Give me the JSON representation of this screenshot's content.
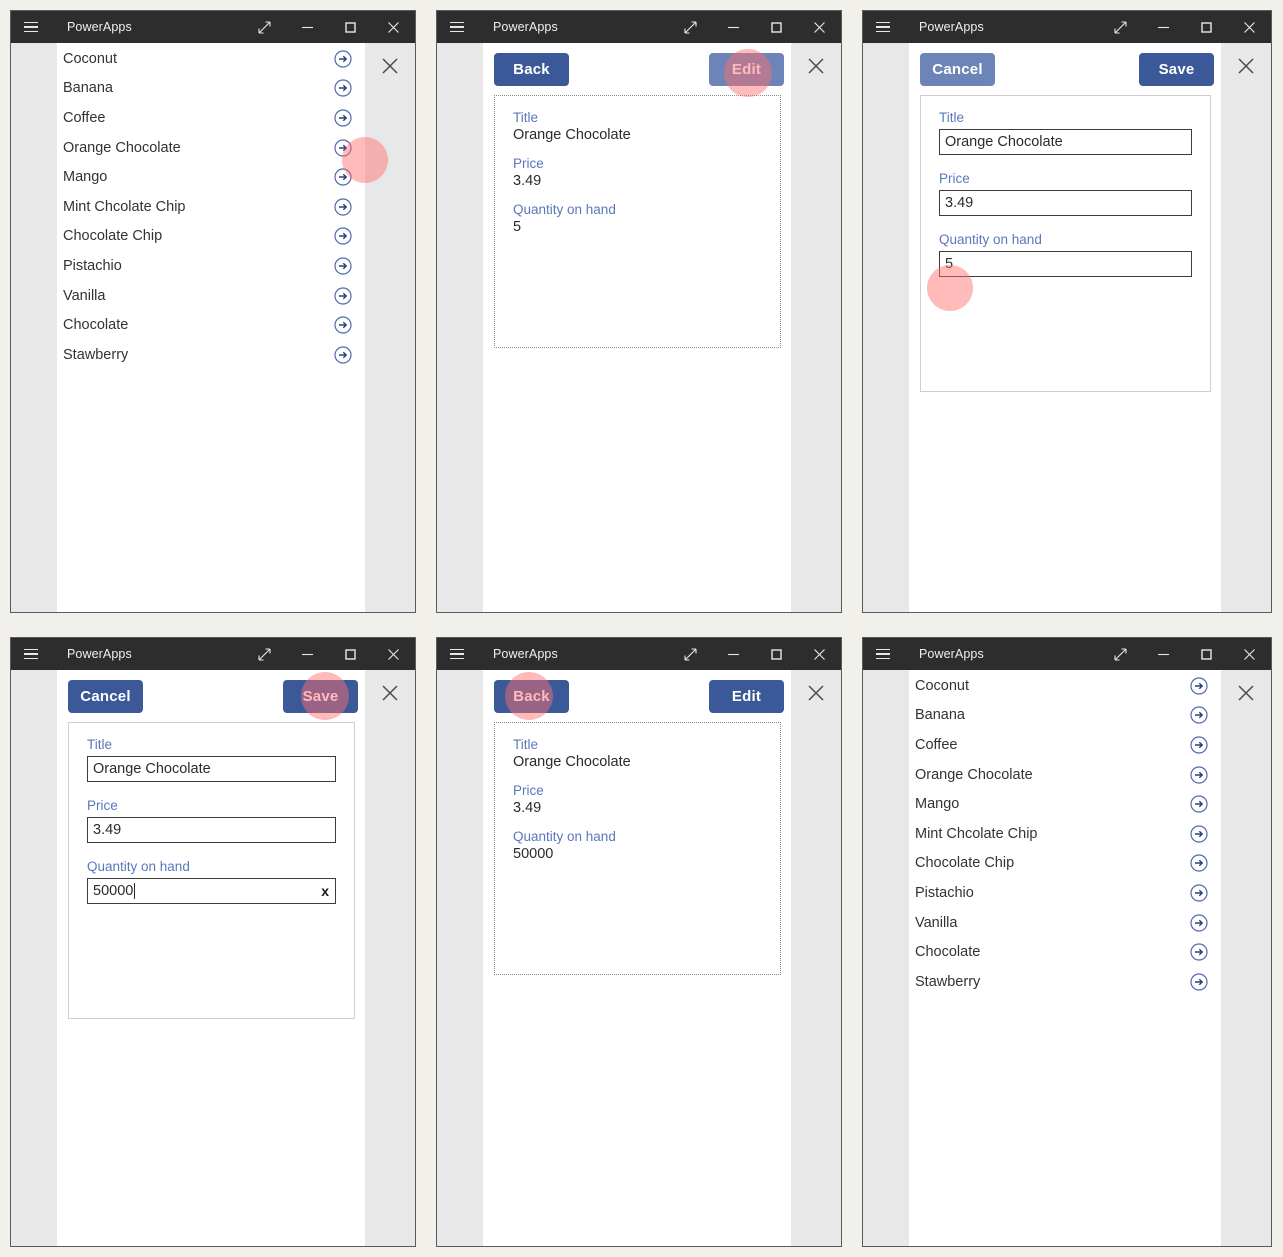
{
  "window": {
    "title": "PowerApps",
    "controls": {
      "menu": "hamburger-menu",
      "restore": "restore-arrows",
      "minimize": "minimize",
      "maximize": "maximize",
      "close": "close"
    },
    "app_close_label": "close-app"
  },
  "colors": {
    "accent": "#3b5998",
    "accent_hover": "#6c84b8",
    "label_blue": "#5a78bb",
    "titlebar": "#2d2d2d",
    "page_bg": "#f1f0ea",
    "app_bg": "#e8e8e8",
    "highlight": "#ff6e6e"
  },
  "gallery": {
    "items": [
      {
        "label": "Coconut"
      },
      {
        "label": "Banana"
      },
      {
        "label": "Coffee"
      },
      {
        "label": "Orange Chocolate"
      },
      {
        "label": "Mango"
      },
      {
        "label": "Mint Chcolate Chip"
      },
      {
        "label": "Chocolate Chip"
      },
      {
        "label": "Pistachio"
      },
      {
        "label": "Vanilla"
      },
      {
        "label": "Chocolate"
      },
      {
        "label": "Stawberry"
      }
    ]
  },
  "detail_before": {
    "back_label": "Back",
    "edit_label": "Edit",
    "fields": [
      {
        "label": "Title",
        "value": "Orange Chocolate"
      },
      {
        "label": "Price",
        "value": "3.49"
      },
      {
        "label": "Quantity on hand",
        "value": "5"
      }
    ]
  },
  "detail_after": {
    "back_label": "Back",
    "edit_label": "Edit",
    "fields": [
      {
        "label": "Title",
        "value": "Orange Chocolate"
      },
      {
        "label": "Price",
        "value": "3.49"
      },
      {
        "label": "Quantity on hand",
        "value": "50000"
      }
    ]
  },
  "edit_before": {
    "cancel_label": "Cancel",
    "save_label": "Save",
    "fields": [
      {
        "label": "Title",
        "value": "Orange Chocolate"
      },
      {
        "label": "Price",
        "value": "3.49"
      },
      {
        "label": "Quantity on hand",
        "value": "5"
      }
    ]
  },
  "edit_after": {
    "cancel_label": "Cancel",
    "save_label": "Save",
    "fields": [
      {
        "label": "Title",
        "value": "Orange Chocolate"
      },
      {
        "label": "Price",
        "value": "3.49"
      },
      {
        "label": "Quantity on hand",
        "value": "50000"
      }
    ],
    "clear_icon": "x"
  },
  "panels": [
    {
      "id": "panel-1",
      "screen": "gallery",
      "highlight": "gallery-row-orange-chocolate-arrow"
    },
    {
      "id": "panel-2",
      "screen": "detail-before",
      "highlight": "edit-button"
    },
    {
      "id": "panel-3",
      "screen": "edit-before",
      "highlight": "quantity-input"
    },
    {
      "id": "panel-4",
      "screen": "edit-after",
      "highlight": "save-button"
    },
    {
      "id": "panel-5",
      "screen": "detail-after",
      "highlight": "back-button"
    },
    {
      "id": "panel-6",
      "screen": "gallery",
      "highlight": null
    }
  ]
}
